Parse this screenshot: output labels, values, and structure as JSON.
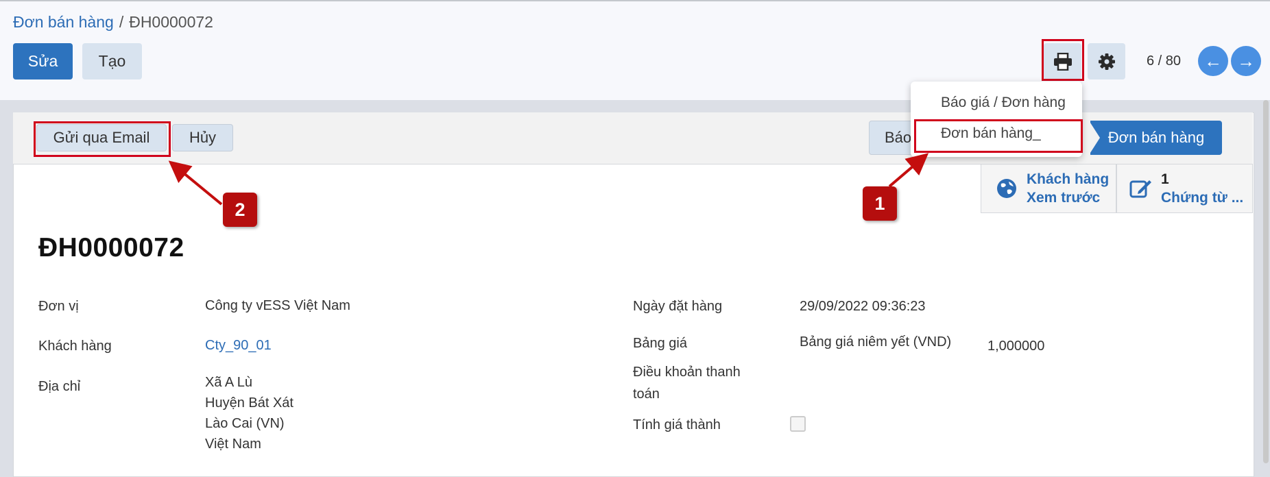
{
  "breadcrumb": {
    "parent": "Đơn bán hàng",
    "separator": "/",
    "current": "ĐH0000072"
  },
  "toolbar": {
    "edit_label": "Sửa",
    "create_label": "Tạo"
  },
  "actions": {
    "print_icon": "print-icon",
    "settings_icon": "gear-icon"
  },
  "pager": {
    "value": "6 / 80",
    "prev_icon": "arrow-left-icon",
    "next_icon": "arrow-right-icon"
  },
  "print_menu": {
    "items": [
      "Báo giá / Đơn hàng",
      "Đơn bán hàng_"
    ]
  },
  "statusbar": {
    "send_email_label": "Gửi qua Email",
    "cancel_label": "Hủy",
    "stage_quote": "Báo",
    "stage_active": "Đơn bán hàng"
  },
  "smart_buttons": {
    "preview": {
      "icon": "globe-icon",
      "line1": "Khách hàng",
      "line2": "Xem trước"
    },
    "documents": {
      "icon": "edit-icon",
      "count": "1",
      "label": "Chứng từ ..."
    }
  },
  "annotations": {
    "badge1": "1",
    "badge2": "2"
  },
  "form": {
    "title": "ĐH0000072",
    "company_label": "Đơn vị",
    "company_value": "Công ty vESS Việt Nam",
    "customer_label": "Khách hàng",
    "customer_value": "Cty_90_01",
    "address_label": "Địa chỉ",
    "address_lines": [
      "Xã A Lù",
      "Huyện Bát Xát",
      "Lào Cai (VN)",
      "Việt Nam"
    ],
    "order_date_label": "Ngày đặt hàng",
    "order_date_value": "29/09/2022 09:36:23",
    "pricelist_label": "Bảng giá",
    "pricelist_value": "Bảng giá niêm yết (VND)",
    "rate_value": "1,000000",
    "payment_terms_label_1": "Điều khoản thanh",
    "payment_terms_label_2": "toán",
    "costing_label": "Tính giá thành",
    "costing_checked": false
  },
  "colors": {
    "primary": "#2d73be",
    "link": "#2c6cb5",
    "annotation_red": "#d0021b",
    "badge_red": "#b50e0e"
  }
}
